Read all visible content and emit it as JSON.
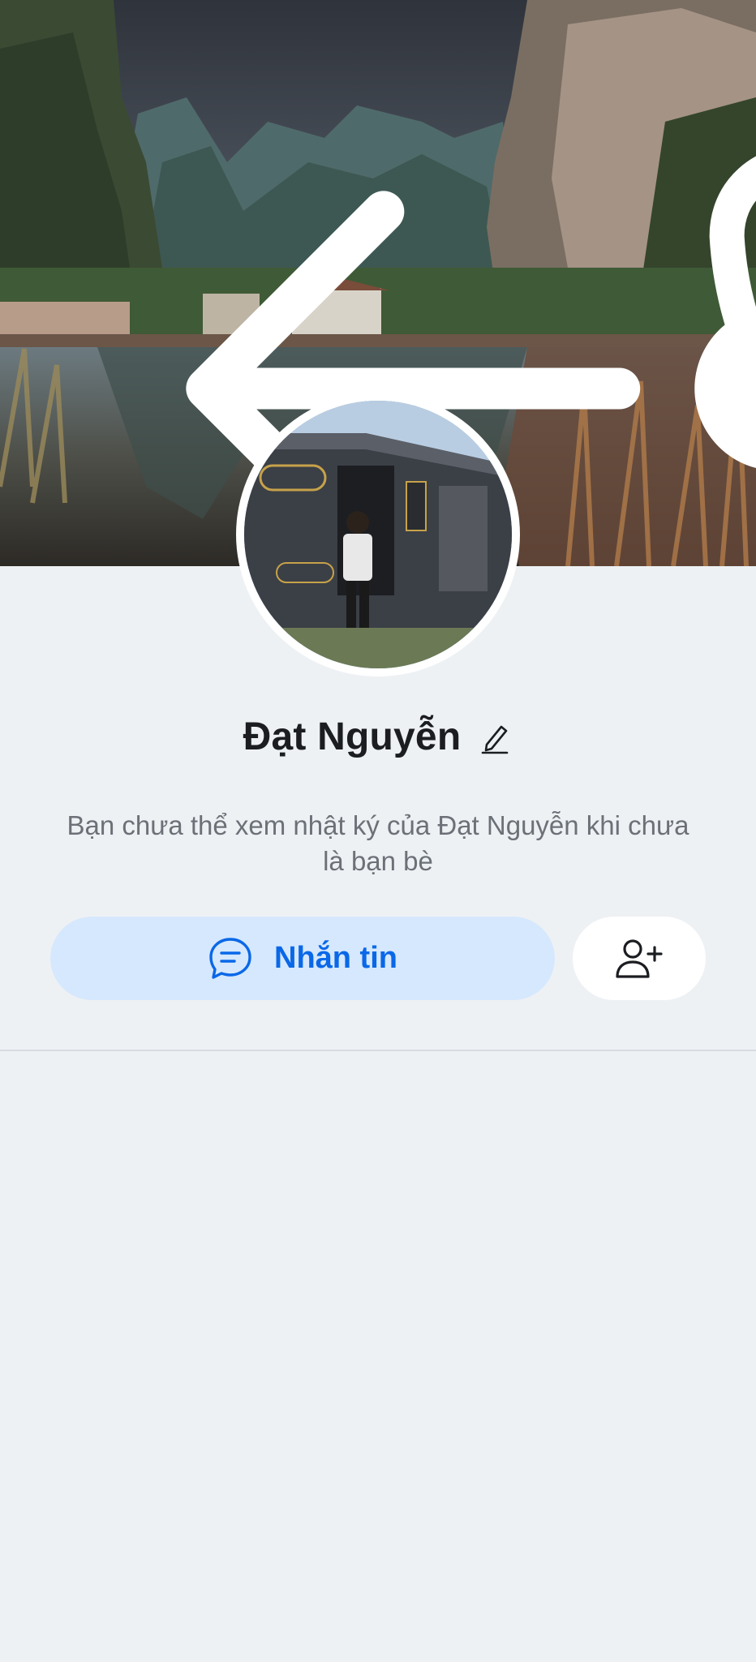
{
  "header": {
    "back_icon": "arrow-left-icon",
    "call_icon": "phone-icon",
    "more_icon": "more-horizontal-icon"
  },
  "profile": {
    "name": "Đạt Nguyễn",
    "edit_icon": "pencil-icon",
    "privacy_note": "Bạn chưa thể xem nhật ký của Đạt Nguyễn khi chưa là bạn bè"
  },
  "actions": {
    "message_label": "Nhắn tin",
    "message_icon": "chat-bubble-icon",
    "add_friend_icon": "add-user-icon"
  },
  "colors": {
    "accent": "#0a68e8",
    "message_button_bg": "#d6e8fd",
    "page_bg": "#eef1f4"
  }
}
